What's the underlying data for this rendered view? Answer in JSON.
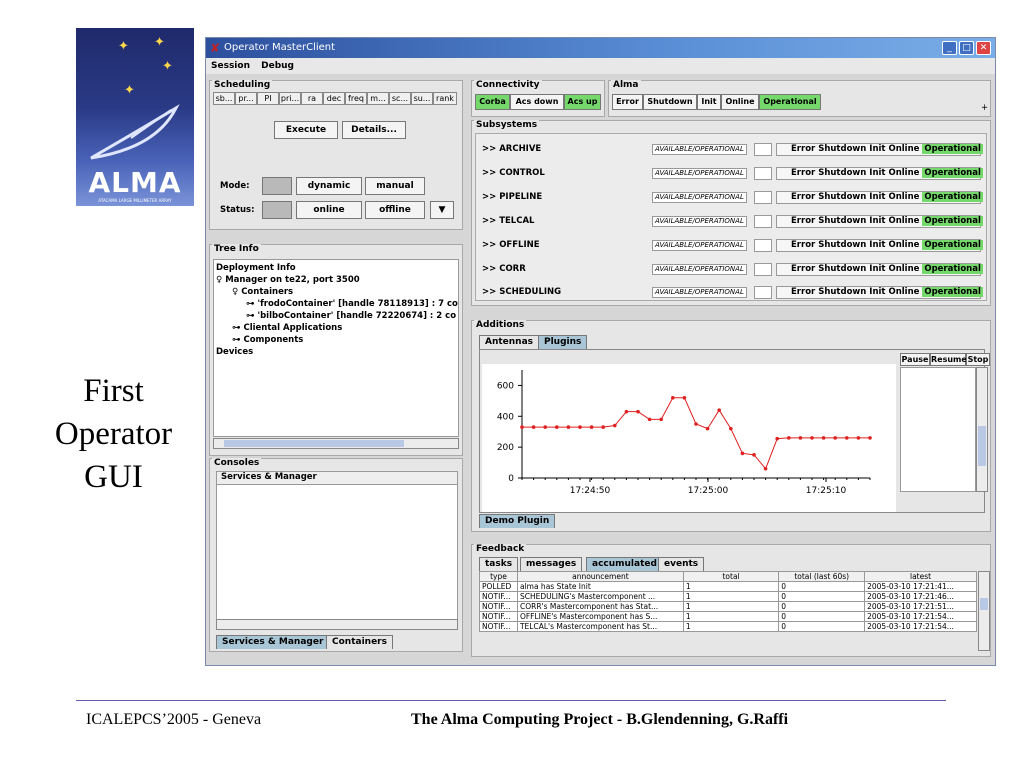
{
  "logo": {
    "text": "ALMA",
    "subtitle": "ATACAMA LARGE MILLIMETER ARRAY"
  },
  "side_caption": [
    "First",
    "Operator",
    "GUI"
  ],
  "footer": {
    "left": "ICALEPCS’2005 - Geneva",
    "right": "The Alma Computing Project - B.Glendenning, G.Raffi"
  },
  "window": {
    "title": "Operator MasterClient",
    "menu": [
      "Session",
      "Debug"
    ]
  },
  "scheduling": {
    "title": "Scheduling",
    "columns": [
      "sb...",
      "pr...",
      "PI",
      "pri...",
      "ra",
      "dec",
      "freq",
      "m...",
      "sc...",
      "su...",
      "rank"
    ],
    "execute": "Execute",
    "details": "Details...",
    "mode_label": "Mode:",
    "mode_buttons": [
      "dynamic",
      "manual"
    ],
    "status_label": "Status:",
    "status_buttons": [
      "online",
      "offline"
    ],
    "dropdown_icon": "triangle-down"
  },
  "tree": {
    "title": "Tree Info",
    "items": [
      "Deployment Info",
      "Manager on te22, port 3500",
      "Containers",
      "'frodoContainer' [handle 78118913] : 7 co",
      "'bilboContainer' [handle 72220674] : 2 co",
      "Cliental Applications",
      "Components",
      "Devices"
    ]
  },
  "consoles": {
    "title": "Consoles",
    "header": "Services & Manager",
    "tabs": [
      "Services & Manager",
      "Containers"
    ]
  },
  "connectivity": {
    "title": "Connectivity",
    "items": [
      "Corba",
      "Acs down",
      "Acs up"
    ]
  },
  "alma": {
    "title": "Alma",
    "buttons": [
      "Error",
      "Shutdown",
      "Init",
      "Online",
      "Operational"
    ]
  },
  "subsystems": {
    "title": "Subsystems",
    "state": "AVAILABLE/OPERATIONAL",
    "controls": [
      "Error",
      "Shutdown",
      "Init",
      "Online",
      "Operational"
    ],
    "items": [
      ">> ARCHIVE",
      ">> CONTROL",
      ">> PIPELINE",
      ">> TELCAL",
      ">> OFFLINE",
      ">> CORR",
      ">> SCHEDULING"
    ]
  },
  "additions": {
    "title": "Additions",
    "tabs": [
      "Antennas",
      "Plugins"
    ],
    "log_buttons": [
      "Pause",
      "Resume",
      "Stop"
    ],
    "bottom_tab": "Demo Plugin"
  },
  "chart_data": {
    "type": "line",
    "x_ticks": [
      "17:24:50",
      "17:25:00",
      "17:25:10"
    ],
    "y_ticks": [
      0,
      200,
      400,
      600
    ],
    "ylim": [
      0,
      700
    ],
    "values": [
      330,
      330,
      330,
      330,
      330,
      330,
      330,
      330,
      340,
      430,
      430,
      380,
      380,
      520,
      520,
      350,
      320,
      440,
      320,
      160,
      150,
      60,
      255,
      260,
      260,
      260,
      260,
      260,
      260,
      260,
      260
    ],
    "series_color": "#e02020"
  },
  "feedback": {
    "title": "Feedback",
    "tabs": [
      "tasks",
      "messages",
      "accumulated",
      "events"
    ],
    "columns": [
      "type",
      "announcement",
      "total",
      "total (last 60s)",
      "latest"
    ],
    "rows": [
      [
        "POLLED",
        "alma has State Init",
        "1",
        "0",
        "2005-03-10 17:21:41..."
      ],
      [
        "NOTIF...",
        "SCHEDULING's Mastercomponent ...",
        "1",
        "0",
        "2005-03-10 17:21:46..."
      ],
      [
        "NOTIF...",
        "CORR's Mastercomponent has Stat...",
        "1",
        "0",
        "2005-03-10 17:21:51..."
      ],
      [
        "NOTIF...",
        "OFFLINE's Mastercomponent has S...",
        "1",
        "0",
        "2005-03-10 17:21:54..."
      ],
      [
        "NOTIF...",
        "TELCAL's Mastercomponent has St...",
        "1",
        "0",
        "2005-03-10 17:21:54..."
      ]
    ]
  }
}
